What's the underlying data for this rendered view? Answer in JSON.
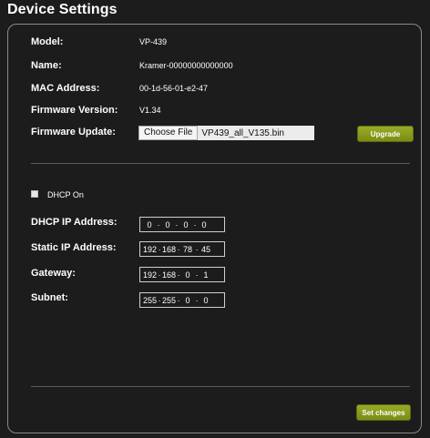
{
  "header": {
    "title": "Device Settings"
  },
  "info": {
    "model_label": "Model:",
    "model_value": "VP-439",
    "name_label": "Name:",
    "name_value": "Kramer-00000000000000",
    "mac_label": "MAC Address:",
    "mac_value": "00-1d-56-01-e2-47",
    "firmware_label": "Firmware Version:",
    "firmware_value": "V1.34",
    "update_label": "Firmware Update:",
    "choose_file_label": "Choose File",
    "file_name": "VP439_all_V135.bin",
    "upgrade_label": "Upgrade"
  },
  "network": {
    "dhcp_label": "DHCP On",
    "dhcp_checked": false,
    "dhcp_ip_label": "DHCP IP Address:",
    "dhcp_ip": [
      "0",
      "0",
      "0",
      "0"
    ],
    "static_ip_label": "Static IP Address:",
    "static_ip": [
      "192",
      "168",
      "78",
      "45"
    ],
    "gateway_label": "Gateway:",
    "gateway": [
      "192",
      "168",
      "0",
      "1"
    ],
    "subnet_label": "Subnet:",
    "subnet": [
      "255",
      "255",
      "0",
      "0"
    ],
    "octet_separator": "·"
  },
  "footer": {
    "set_changes_label": "Set changes"
  },
  "colors": {
    "accent": "#8a9a1e",
    "background": "#1c1c1c",
    "border": "#8a8a8a"
  }
}
